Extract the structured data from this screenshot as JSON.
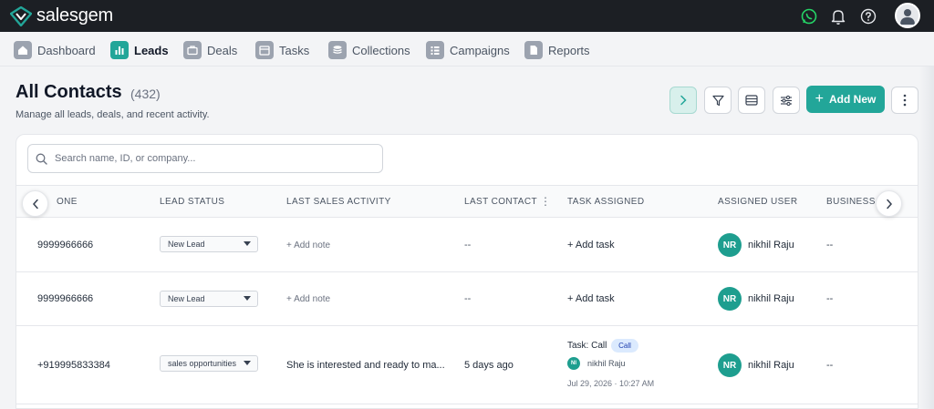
{
  "app": {
    "name": "salesgem",
    "colors": {
      "brand": "#22a699",
      "topbar": "#1c1f24",
      "whatsapp": "#25d366",
      "call_badge": "#dbeafe"
    }
  },
  "topbar": {
    "icons": [
      "whatsapp-icon",
      "bell-icon",
      "help-icon",
      "user-avatar-icon"
    ]
  },
  "nav": {
    "items": [
      {
        "label": "Dashboard",
        "icon": "home-icon",
        "active": false
      },
      {
        "label": "Leads",
        "icon": "bar-chart-icon",
        "active": true
      },
      {
        "label": "Deals",
        "icon": "briefcase-icon",
        "active": false
      },
      {
        "label": "Tasks",
        "icon": "calendar-icon",
        "active": false
      },
      {
        "label": "Collections",
        "icon": "coins-icon",
        "active": false
      },
      {
        "label": "Campaigns",
        "icon": "list-icon",
        "active": false
      },
      {
        "label": "Reports",
        "icon": "document-icon",
        "active": false
      }
    ]
  },
  "header": {
    "title": "All Contacts",
    "count": "(432)",
    "subtitle": "Manage all leads, deals, and recent activity."
  },
  "toolbar": {
    "add_new_label": "Add New",
    "buttons": [
      "expand-chevron-icon",
      "filter-icon",
      "table-view-icon",
      "sliders-icon",
      "more-vertical-icon"
    ]
  },
  "search": {
    "placeholder": "Search name, ID, or company..."
  },
  "table": {
    "columns": [
      "ONE",
      "LEAD STATUS",
      "LAST SALES ACTIVITY",
      "LAST CONTACT",
      "TASK ASSIGNED",
      "ASSIGNED USER",
      "BUSINESS T"
    ],
    "rows": [
      {
        "phone": "9999966666",
        "status": "New Lead",
        "activity": "+ Add note",
        "last_contact": "--",
        "task": "+ Add task",
        "user_initials": "NR",
        "user_name": "nikhil Raju",
        "business": "--"
      },
      {
        "phone": "9999966666",
        "status": "New Lead",
        "activity": "+ Add note",
        "last_contact": "--",
        "task": "+ Add task",
        "user_initials": "NR",
        "user_name": "nikhil Raju",
        "business": "--"
      },
      {
        "phone": "+919995833384",
        "status": "sales opportunities",
        "activity": "She is interested and ready to ma...",
        "last_contact": "5 days ago",
        "task_title": "Task: Call",
        "task_badge": "Call",
        "task_user_initials": "NI",
        "task_user_name": "nikhil Raju",
        "task_date": "Jul 29, 2026 · 10:27 AM",
        "user_initials": "NR",
        "user_name": "nikhil Raju",
        "business": "--"
      }
    ]
  }
}
